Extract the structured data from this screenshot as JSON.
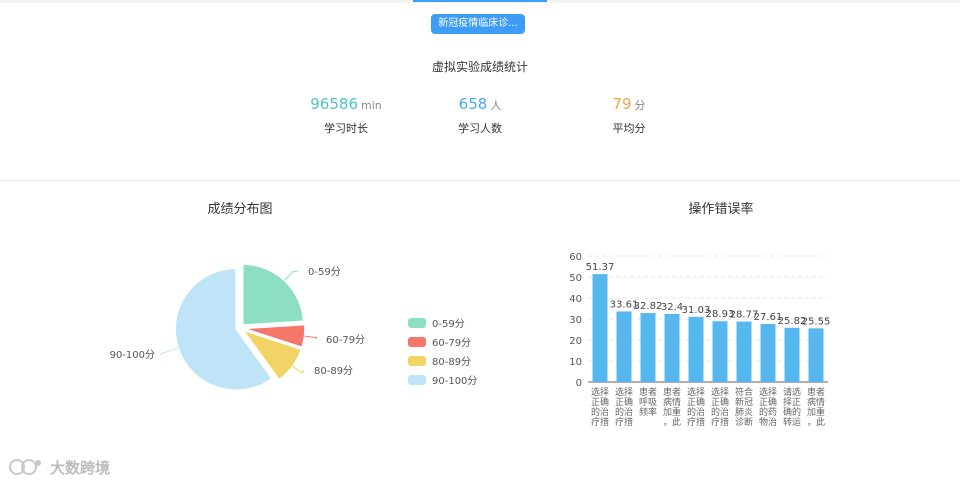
{
  "tab": {
    "label": "新冠疫情临床诊..."
  },
  "stats": {
    "title": "虚拟实验成绩统计",
    "items": [
      {
        "value": "96586",
        "unit": "min",
        "label": "学习时长",
        "color": "#4ec4c4"
      },
      {
        "value": "658",
        "unit": "人",
        "label": "学习人数",
        "color": "#49a9ee"
      },
      {
        "value": "79",
        "unit": "分",
        "label": "平均分",
        "color": "#f3a34b"
      }
    ]
  },
  "pie_section": {
    "title": "成绩分布图"
  },
  "bar_section": {
    "title": "操作错误率"
  },
  "watermark": {
    "text": "大数跨境"
  },
  "chart_data": [
    {
      "type": "pie",
      "title": "成绩分布图",
      "slices": [
        {
          "label": "0-59分",
          "value": 24,
          "color": "#8ddfc4"
        },
        {
          "label": "60-79分",
          "value": 6,
          "color": "#f7766a"
        },
        {
          "label": "80-89分",
          "value": 10,
          "color": "#f2d366"
        },
        {
          "label": "90-100分",
          "value": 60,
          "color": "#bfe4f7"
        }
      ],
      "legend_position": "right"
    },
    {
      "type": "bar",
      "title": "操作错误率",
      "categories": [
        "选择正确的治疗措",
        "选择正确的治疗措",
        "患者呼吸频率",
        "患者病情加重，此",
        "选择正确的治疗措",
        "选择正确的治疗措",
        "符合新冠肺炎诊断",
        "选择正确的药物治",
        "请选择正确的转运",
        "患者病情加重，此"
      ],
      "category_lines": [
        [
          "选择",
          "正确",
          "的治",
          "疗措"
        ],
        [
          "选择",
          "正确",
          "的治",
          "疗措"
        ],
        [
          "患者",
          "呼吸",
          "频率"
        ],
        [
          "患者",
          "病情",
          "加重",
          "，此"
        ],
        [
          "选择",
          "正确",
          "的治",
          "疗措"
        ],
        [
          "选择",
          "正确",
          "的治",
          "疗措"
        ],
        [
          "符合",
          "新冠",
          "肺炎",
          "诊断"
        ],
        [
          "选择",
          "正确",
          "的药",
          "物治"
        ],
        [
          "请选",
          "择正",
          "确的",
          "转运"
        ],
        [
          "患者",
          "病情",
          "加重",
          "，此"
        ]
      ],
      "values": [
        51.37,
        33.61,
        32.82,
        32.4,
        31.03,
        28.93,
        28.77,
        27.61,
        25.82,
        25.55
      ],
      "value_labels": [
        "51.37",
        "33.61",
        "32.82",
        "32.4",
        "31.03",
        "28.93",
        "28.77",
        "27.61",
        "25.82",
        "25.55"
      ],
      "yticks": [
        0,
        10,
        20,
        30,
        40,
        50,
        60
      ],
      "ylim": [
        0,
        60
      ],
      "bar_color": "#57b8f0",
      "grid": true
    }
  ]
}
